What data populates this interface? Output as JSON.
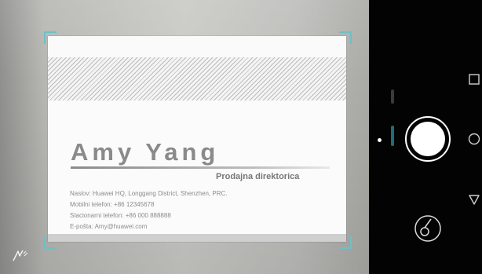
{
  "card": {
    "name": "Amy Yang",
    "title": "Prodajna direktorica",
    "lines": [
      "Naslov: Huawei HQ, Longgang District, Shenzhen, PRC.",
      "Mobilni telefon: +86 12345678",
      "Stacionarni telefon: +86 000 888888",
      "E-pošta: Amy@huawei.com"
    ]
  },
  "controls": {
    "flash_icon": "flash-auto-icon",
    "shutter": "shutter-button",
    "mode_switch": "camera-mode-switch-icon"
  },
  "nav": {
    "recents": "square-icon",
    "home": "circle-icon",
    "back": "triangle-back-icon"
  },
  "colors": {
    "frame_corner": "#6fbfc6",
    "name_text": "#8a8a8a"
  }
}
